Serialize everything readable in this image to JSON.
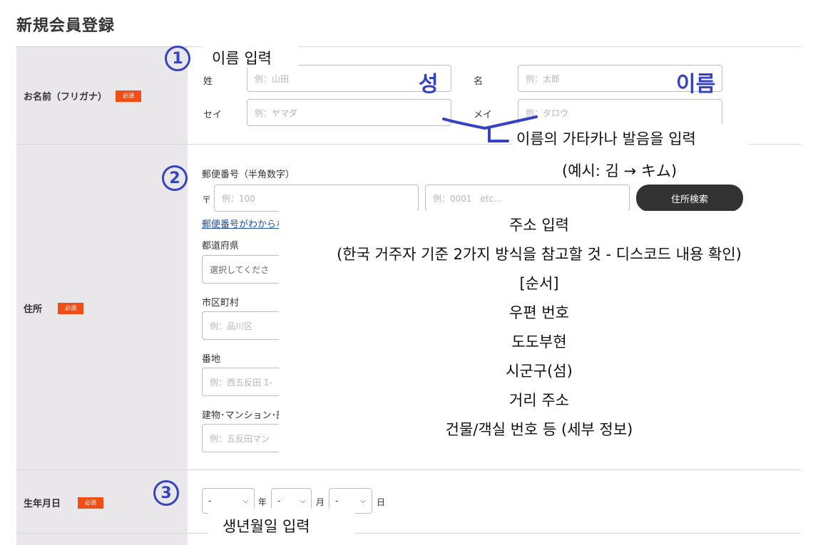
{
  "page_title": "新規会員登録",
  "name_row": {
    "label": "お名前（フリガナ）",
    "required": "必須",
    "sei_label": "姓",
    "sei_placeholder": "例：山田",
    "mei_label": "名",
    "mei_placeholder": "例：太郎",
    "sei_kana_label": "セイ",
    "sei_kana_placeholder": "例：ヤマダ",
    "mei_kana_label": "メイ",
    "mei_kana_placeholder": "例：タロウ"
  },
  "address_row": {
    "label": "住所",
    "required": "必須",
    "postal_label": "郵便番号（半角数字）",
    "postal_mark": "〒",
    "postal1_placeholder": "例：100",
    "postal2_placeholder": "例：0001　etc...",
    "search_button": "住所検索",
    "postal_unknown_link": "郵便番号がわからな",
    "prefecture_label": "都道府県",
    "prefecture_placeholder": "選択してくださ",
    "city_label": "市区町村",
    "city_placeholder": "例：品川区",
    "street_label": "番地",
    "street_placeholder": "例：西五反田 1-",
    "building_label": "建物･マンション･部",
    "building_placeholder": "例：五反田マン"
  },
  "birth_row": {
    "label": "生年月日",
    "required": "必須",
    "year_value": "-",
    "year_unit": "年",
    "month_value": "-",
    "month_unit": "月",
    "day_value": "-",
    "day_unit": "日"
  },
  "annotations": {
    "num1": "1",
    "name_input": "이름 입력",
    "sei": "성",
    "mei": "이름",
    "kana_note1": "이름의 가타카나 발음을 입력",
    "kana_note2": "(예시: 김 → キム)",
    "num2": "2",
    "addr_lines": [
      "주소 입력",
      "(한국 거주자 기준 2가지 방식을 참고할 것 - 디스코드 내용 확인)",
      "[순서]",
      "우편 번호",
      "도도부현",
      "시군구(섬)",
      "거리 주소",
      "건물/객실 번호 등 (세부 정보)"
    ],
    "num3": "3",
    "birth_input": "생년월일 입력"
  },
  "colors": {
    "required_badge": "#f04e16",
    "annotation_blue": "#3543c2",
    "label_column": "#e9e7e9",
    "button": "#333333"
  }
}
